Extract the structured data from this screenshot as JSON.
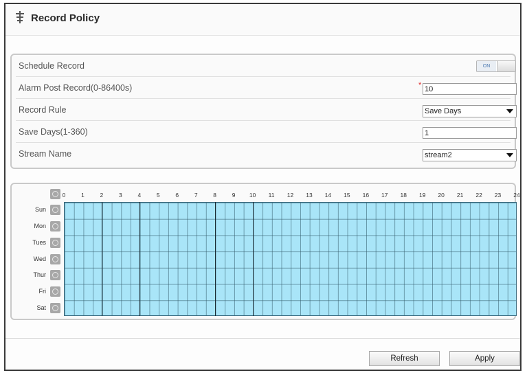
{
  "page": {
    "title": "Record Policy",
    "title_icon": "record-policy-icon"
  },
  "settings": {
    "schedule_record": {
      "label": "Schedule Record",
      "toggle_text": "ON",
      "enabled": true
    },
    "alarm_post_record": {
      "label": "Alarm Post Record(0-86400s)",
      "required_mark": "*",
      "value": "10"
    },
    "record_rule": {
      "label": "Record Rule",
      "selected": "Save Days"
    },
    "save_days": {
      "label": "Save Days(1-360)",
      "value": "1"
    },
    "stream_name": {
      "label": "Stream Name",
      "selected": "stream2"
    }
  },
  "schedule": {
    "hours": [
      "0",
      "1",
      "2",
      "3",
      "4",
      "5",
      "6",
      "7",
      "8",
      "9",
      "10",
      "11",
      "12",
      "13",
      "14",
      "15",
      "16",
      "17",
      "18",
      "19",
      "20",
      "21",
      "22",
      "23",
      "24"
    ],
    "days": [
      "Sun",
      "Mon",
      "Tues",
      "Wed",
      "Thur",
      "Fri",
      "Sat"
    ],
    "all_selected": true,
    "fill_color": "#a9e5f8",
    "line_color": "#3a6b80"
  },
  "buttons": {
    "refresh": "Refresh",
    "apply": "Apply"
  }
}
